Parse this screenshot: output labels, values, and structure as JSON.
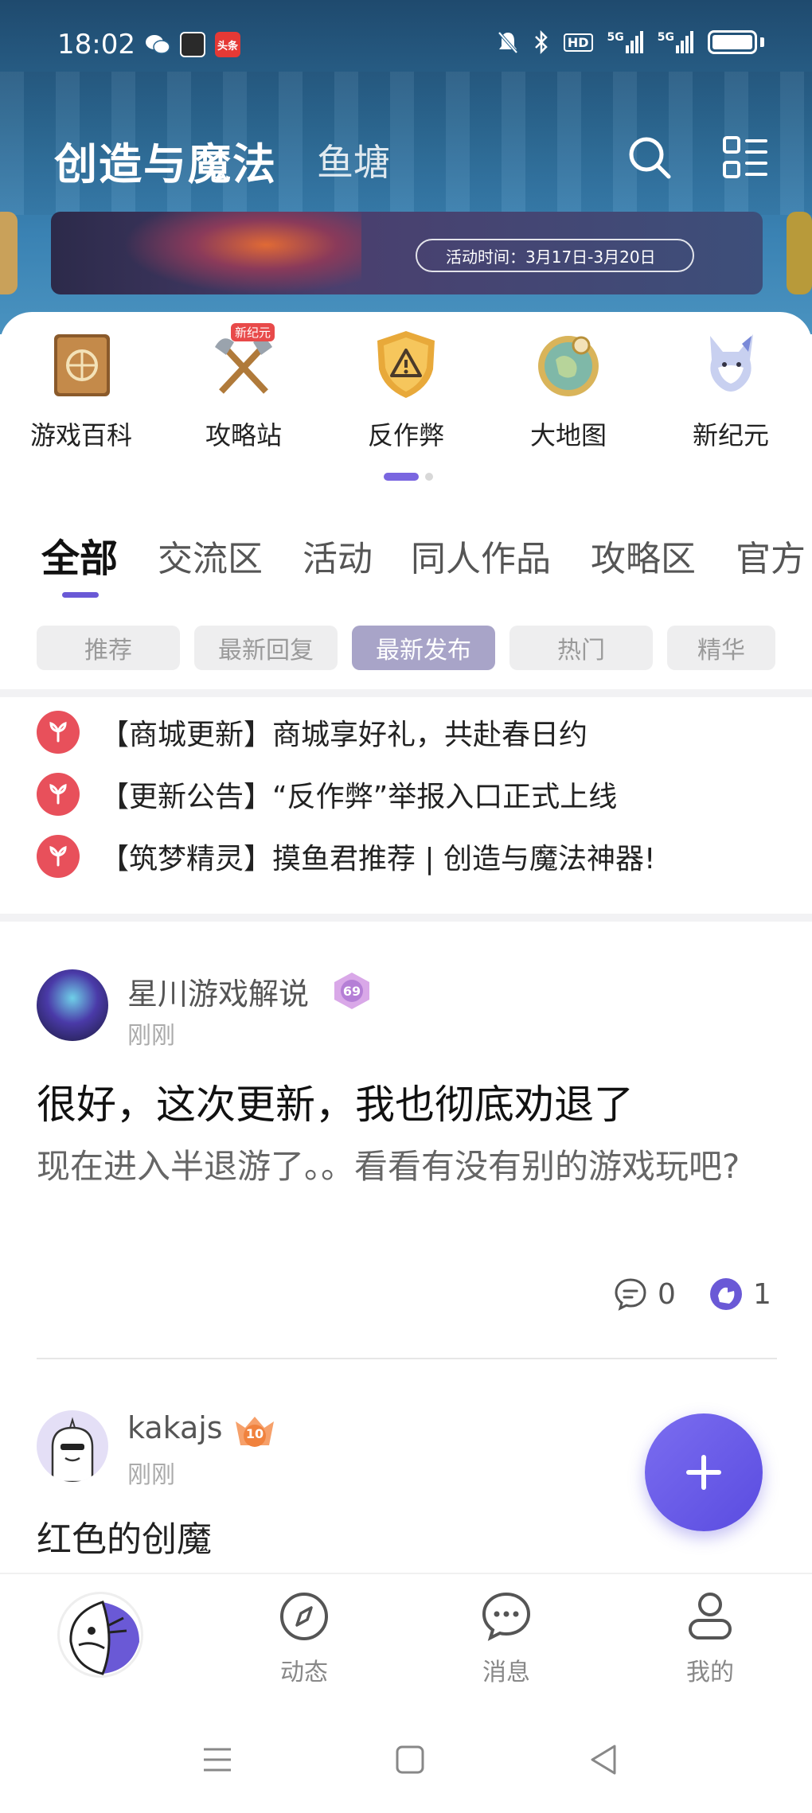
{
  "status_bar": {
    "time": "18:02",
    "apps": [
      {
        "icon": "wechat-icon",
        "label": ""
      },
      {
        "icon": "game-app-icon",
        "label": ""
      },
      {
        "icon": "toutiao-icon",
        "label": "头条"
      }
    ],
    "indicators": {
      "hd": "HD",
      "net1": "5G",
      "net2": "5G"
    }
  },
  "header": {
    "title": "创造与魔法",
    "subtitle": "鱼塘",
    "search_icon": "search-icon",
    "menu_icon": "category-menu-icon"
  },
  "banner": {
    "activity_time": "活动时间：3月17日-3月20日"
  },
  "shortcuts": [
    {
      "label": "游戏百科",
      "icon": "encyclopedia-book-icon",
      "badge": ""
    },
    {
      "label": "攻略站",
      "icon": "crossed-axes-icon",
      "badge": "新纪元"
    },
    {
      "label": "反作弊",
      "icon": "warning-shield-icon",
      "badge": ""
    },
    {
      "label": "大地图",
      "icon": "world-map-icon",
      "badge": ""
    },
    {
      "label": "新纪元",
      "icon": "creature-icon",
      "badge": ""
    }
  ],
  "tabs": [
    {
      "label": "全部",
      "active": true
    },
    {
      "label": "交流区",
      "active": false
    },
    {
      "label": "活动",
      "active": false
    },
    {
      "label": "同人作品",
      "active": false
    },
    {
      "label": "攻略区",
      "active": false
    },
    {
      "label": "官方",
      "active": false
    }
  ],
  "chips": [
    {
      "label": "推荐",
      "active": false
    },
    {
      "label": "最新回复",
      "active": false
    },
    {
      "label": "最新发布",
      "active": true
    },
    {
      "label": "热门",
      "active": false
    },
    {
      "label": "精华",
      "active": false
    }
  ],
  "notices": [
    {
      "text": "【商城更新】商城享好礼，共赴春日约"
    },
    {
      "text": "【更新公告】“反作弊”举报入口正式上线"
    },
    {
      "text": "【筑梦精灵】摸鱼君推荐 | 创造与魔法神器!"
    }
  ],
  "posts": [
    {
      "author": "星川游戏解说",
      "level": "69",
      "time": "刚刚",
      "title": "很好，这次更新，我也彻底劝退了",
      "body": "现在进入半退游了。。看看有没有别的游戏玩吧?",
      "comments": "0",
      "likes": "1"
    },
    {
      "author": "kakajs",
      "level": "10",
      "time": "刚刚",
      "title": "红色的创魔"
    }
  ],
  "fab": {
    "icon": "plus-icon"
  },
  "bottom_nav": [
    {
      "label": "",
      "icon": "fish-home-icon"
    },
    {
      "label": "动态",
      "icon": "compass-icon"
    },
    {
      "label": "消息",
      "icon": "chat-bubble-icon"
    },
    {
      "label": "我的",
      "icon": "person-icon"
    }
  ],
  "colors": {
    "accent": "#6a59d6",
    "fab": "#5a4ce0",
    "notice_red": "#e8505b",
    "header_blue": "#2b6690"
  }
}
